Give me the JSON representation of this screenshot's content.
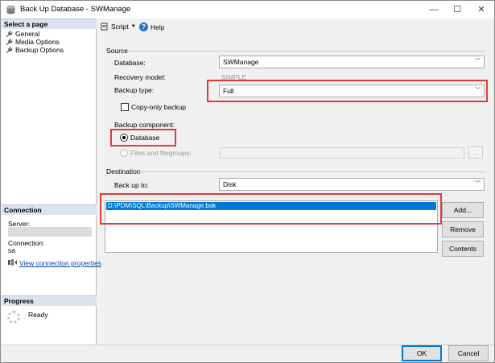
{
  "window": {
    "title": "Back Up Database - SWManage",
    "minimize": "—",
    "maximize": "☐",
    "close": "✕"
  },
  "left_pane": {
    "select_page_header": "Select a page",
    "pages": [
      {
        "label": "General",
        "icon": "wrench-icon"
      },
      {
        "label": "Media Options",
        "icon": "wrench-icon"
      },
      {
        "label": "Backup Options",
        "icon": "wrench-icon"
      }
    ],
    "connection_header": "Connection",
    "server_label": "Server:",
    "connection_label": "Connection:",
    "connection_value": "sa",
    "view_connection_link": "View connection properties",
    "progress_header": "Progress",
    "progress_status": "Ready"
  },
  "toolbar": {
    "script_label": "Script",
    "help_label": "Help"
  },
  "source": {
    "group_label": "Source",
    "database_label": "Database:",
    "database_value": "SWManage",
    "recovery_label": "Recovery model:",
    "recovery_value": "SIMPLE",
    "backup_type_label": "Backup type:",
    "backup_type_value": "Full",
    "copy_only_label": "Copy-only backup",
    "copy_only_checked": false,
    "component_label": "Backup component:",
    "database_radio_label": "Database",
    "files_radio_label": "Files and filegroups:",
    "browse_button": "..."
  },
  "destination": {
    "group_label": "Destination",
    "backup_to_label": "Back up to:",
    "backup_to_value": "Disk",
    "paths": [
      "D:\\PDM\\SQL\\Backup\\SWManage.bak"
    ],
    "add_button": "Add...",
    "remove_button": "Remove",
    "contents_button": "Contents"
  },
  "footer": {
    "ok_button": "OK",
    "cancel_button": "Cancel"
  },
  "colors": {
    "highlight_red": "#e0393e",
    "selection_blue": "#0078d7",
    "link_blue": "#0645ad"
  }
}
